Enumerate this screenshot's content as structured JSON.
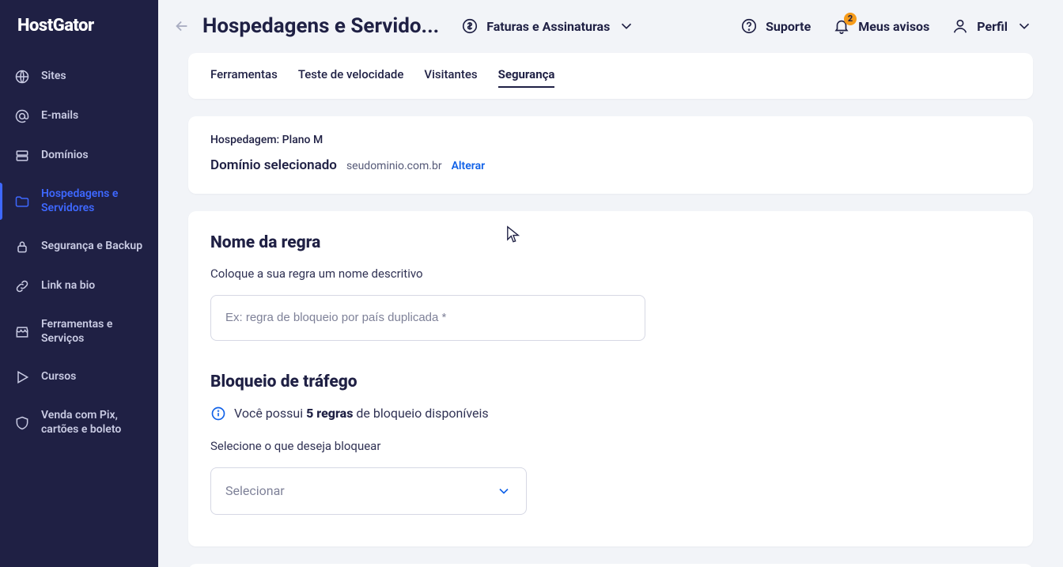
{
  "brand": "HostGator",
  "sidebar": {
    "items": [
      {
        "label": "Sites"
      },
      {
        "label": "E-mails"
      },
      {
        "label": "Domínios"
      },
      {
        "label": "Hospedagens e Servidores"
      },
      {
        "label": "Segurança e Backup"
      },
      {
        "label": "Link na bio"
      },
      {
        "label": "Ferramentas e Serviços"
      },
      {
        "label": "Cursos"
      },
      {
        "label": "Venda com Pix, cartões e boleto"
      }
    ]
  },
  "topbar": {
    "page_title": "Hospedagens e Servido...",
    "billing": "Faturas e Assinaturas",
    "support": "Suporte",
    "notifications_label": "Meus avisos",
    "notifications_badge": "2",
    "profile": "Perfil"
  },
  "tabs": {
    "items": [
      {
        "label": "Ferramentas"
      },
      {
        "label": "Teste de velocidade"
      },
      {
        "label": "Visitantes"
      },
      {
        "label": "Segurança"
      }
    ],
    "active_index": 3
  },
  "hosting": {
    "plan_line": "Hospedagem: Plano M",
    "domain_label": "Domínio selecionado",
    "domain_value": "seudominio.com.br",
    "change": "Alterar"
  },
  "form": {
    "rule_title": "Nome da regra",
    "rule_subtitle": "Coloque a sua regra um nome descritivo",
    "rule_placeholder": "Ex: regra de bloqueio por país duplicada *",
    "block_title": "Bloqueio de tráfego",
    "info_prefix": "Você possui ",
    "info_rules_bold": "5 regras",
    "info_suffix": " de bloqueio disponíveis",
    "select_label": "Selecione o que deseja bloquear",
    "select_placeholder": "Selecionar"
  }
}
